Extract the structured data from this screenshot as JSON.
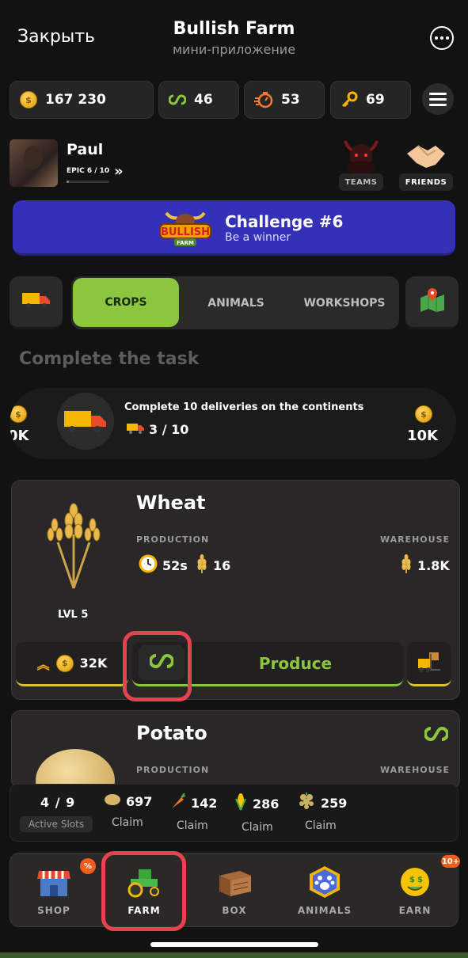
{
  "header": {
    "close_label": "Закрыть",
    "title": "Bullish Farm",
    "subtitle": "мини-приложение",
    "more_icon": "more-horizontal-icon"
  },
  "resources": {
    "coins": "167 230",
    "links": "46",
    "boosts": "53",
    "keys": "69"
  },
  "player": {
    "name": "Paul",
    "rank": "EPIC 6 / 10",
    "rank_progress": 0.0
  },
  "social": {
    "teams_label": "TEAMS",
    "friends_label": "FRIENDS"
  },
  "challenge": {
    "logo_text": "BULLISH",
    "logo_sub": "FARM",
    "title": "Challenge #6",
    "subtitle": "Be a winner"
  },
  "tabs": [
    "CROPS",
    "ANIMALS",
    "WORKSHOPS"
  ],
  "active_tab": "CROPS",
  "task": {
    "heading": "Complete the task",
    "left_reward": "0K",
    "text": "Complete 10 deliveries on the continents",
    "progress": "3 / 10",
    "right_reward": "10K"
  },
  "wheat": {
    "name": "Wheat",
    "production_label": "PRODUCTION",
    "warehouse_label": "WAREHOUSE",
    "time": "52s",
    "amount": "16",
    "warehouse": "1.8K",
    "level": "LVL 5",
    "upgrade_cost": "32K",
    "produce_label": "Produce"
  },
  "potato": {
    "name": "Potato",
    "production_label": "PRODUCTION",
    "warehouse_label": "WAREHOUSE"
  },
  "claim_bar": {
    "slots": "4 / 9",
    "slots_label": "Active Slots",
    "items": [
      {
        "icon": "potato-icon",
        "count": "697",
        "label": "Claim"
      },
      {
        "icon": "carrot-icon",
        "count": "142",
        "label": "Claim"
      },
      {
        "icon": "corn-icon",
        "count": "286",
        "label": "Claim"
      },
      {
        "icon": "grapes-icon",
        "count": "259",
        "label": "Claim"
      }
    ]
  },
  "nav": {
    "items": [
      {
        "label": "SHOP",
        "badge": "%"
      },
      {
        "label": "FARM"
      },
      {
        "label": "BOX"
      },
      {
        "label": "ANIMALS"
      },
      {
        "label": "EARN",
        "badge": "10+"
      }
    ],
    "active": "FARM"
  },
  "colors": {
    "accent_green": "#8cc63f",
    "challenge_blue": "#3431b8",
    "highlight_red": "#e9424f",
    "gold": "#d7c23a"
  }
}
